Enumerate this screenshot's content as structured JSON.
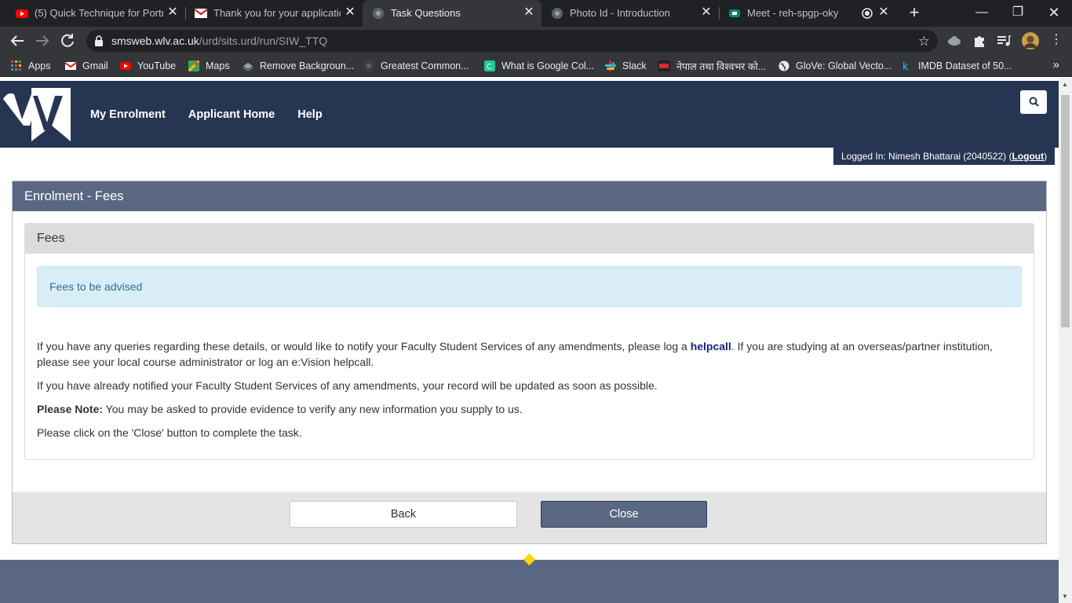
{
  "browser": {
    "tabs": [
      {
        "title": "(5) Quick Technique for Portrait",
        "icon": "youtube-icon",
        "active": false
      },
      {
        "title": "Thank you for your application",
        "icon": "gmail-icon",
        "active": false
      },
      {
        "title": "Task Questions",
        "icon": "globe-icon",
        "active": true
      },
      {
        "title": "Photo Id - Introduction",
        "icon": "globe-icon",
        "active": false
      },
      {
        "title": "Meet - reh-spgp-oky",
        "icon": "google-meet-icon",
        "active": false
      }
    ],
    "url_host": "smsweb.wlv.ac.uk",
    "url_path": "/urd/sits.urd/run/SIW_TTQ",
    "bookmarks": [
      {
        "label": "Apps",
        "icon": "apps-grid-icon"
      },
      {
        "label": "Gmail",
        "icon": "gmail-icon"
      },
      {
        "label": "YouTube",
        "icon": "youtube-icon"
      },
      {
        "label": "Maps",
        "icon": "maps-icon"
      },
      {
        "label": "Remove Backgroun...",
        "icon": "remove-bg-icon"
      },
      {
        "label": "Greatest Common...",
        "icon": "site-icon"
      },
      {
        "label": "What is Google Col...",
        "icon": "c-icon"
      },
      {
        "label": "Slack",
        "icon": "slack-icon"
      },
      {
        "label": "नेपाल तथा विश्वभर को...",
        "icon": "news-icon"
      },
      {
        "label": "GloVe: Global Vecto...",
        "icon": "globe-icon"
      },
      {
        "label": "IMDB Dataset of 50...",
        "icon": "kaggle-icon"
      }
    ],
    "colors": {
      "tabstrip": "#202124",
      "toolbar": "#35363a"
    }
  },
  "site": {
    "nav": [
      "My Enrolment",
      "Applicant Home",
      "Help"
    ],
    "login_prefix": "Logged In: Nimesh Bhattarai (2040522) (",
    "logout": "Logout",
    "login_suffix": ")",
    "colors": {
      "header": "#263652",
      "panel": "#5a6782",
      "info_bg": "#d9edf7",
      "info_text": "#31708f"
    }
  },
  "panel": {
    "title": "Enrolment - Fees",
    "section_title": "Fees",
    "info_message": "Fees to be advised",
    "para1_start": "If you have any queries regarding these details, or would like to notify your Faculty Student Services of any amendments, please log a ",
    "para1_link": "helpcall",
    "para1_end": ". If you are studying at an overseas/partner institution, please see your local course administrator or log an e:Vision helpcall.",
    "para2": "If you have already notified your Faculty Student Services of any amendments, your record will be updated as soon as possible.",
    "note_label": "Please Note:",
    "note_text": " You may be asked to provide evidence to verify any new information you supply to us.",
    "para4": "Please click on the 'Close' button to complete the task.",
    "back_label": "Back",
    "close_label": "Close"
  }
}
